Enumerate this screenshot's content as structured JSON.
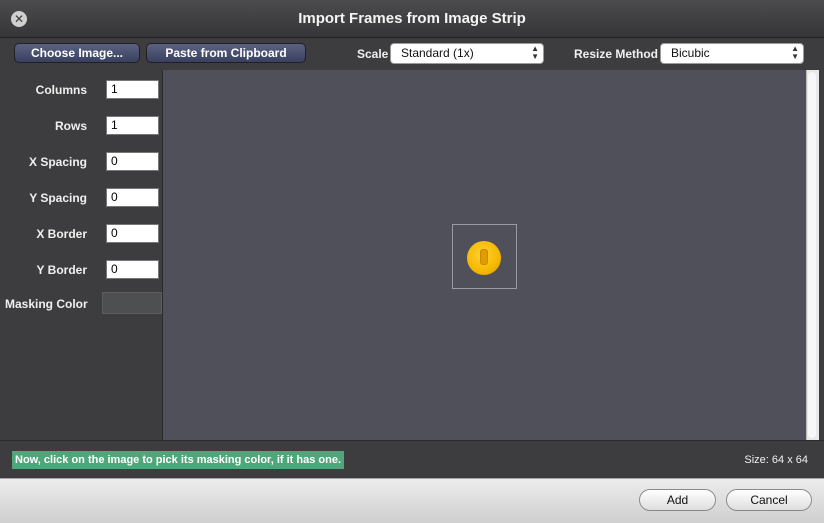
{
  "window": {
    "title": "Import Frames from Image Strip"
  },
  "toolbar": {
    "choose_label": "Choose Image...",
    "paste_label": "Paste from Clipboard",
    "scale_label": "Scale",
    "scale_value": "Standard (1x)",
    "resize_label": "Resize Method",
    "resize_value": "Bicubic"
  },
  "fields": [
    {
      "label": "Columns",
      "value": "1"
    },
    {
      "label": "Rows",
      "value": "1"
    },
    {
      "label": "X Spacing",
      "value": "0"
    },
    {
      "label": "Y Spacing",
      "value": "0"
    },
    {
      "label": "X Border",
      "value": "0"
    },
    {
      "label": "Y Border",
      "value": "0"
    }
  ],
  "masking": {
    "label": "Masking Color"
  },
  "canvas": {
    "image_icon": "coin-icon"
  },
  "status": {
    "hint": "Now, click on the image to pick its masking color, if it has one.",
    "size": "Size: 64 x 64"
  },
  "buttons": {
    "add_label": "Add",
    "cancel_label": "Cancel"
  },
  "colors": {
    "hint_bg": "#4fa67a",
    "canvas_bg": "#4f5059",
    "coin": "#f5b800"
  }
}
